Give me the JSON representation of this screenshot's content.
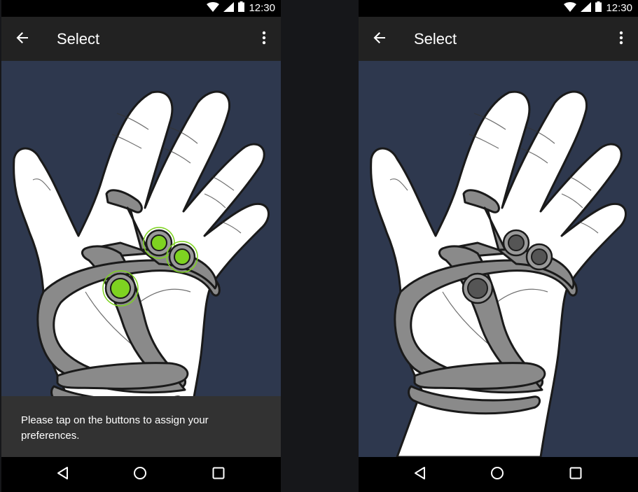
{
  "screens": [
    {
      "status": {
        "time": "12:30",
        "icons": [
          "wifi-icon",
          "cell-signal-icon",
          "battery-icon"
        ]
      },
      "app_bar": {
        "title": "Select",
        "back_icon": "arrow-back-icon",
        "menu_icon": "more-vert-icon"
      },
      "illustration": {
        "subject": "hand-controller",
        "buttons_highlighted": true,
        "highlight_color": "#7ed321"
      },
      "snackbar": {
        "message": "Please tap on the buttons to assign your preferences."
      },
      "nav": {
        "icons": [
          "nav-back-icon",
          "nav-home-icon",
          "nav-recents-icon"
        ]
      }
    },
    {
      "status": {
        "time": "12:30",
        "icons": [
          "wifi-icon",
          "cell-signal-icon",
          "battery-icon"
        ]
      },
      "app_bar": {
        "title": "Select",
        "back_icon": "arrow-back-icon",
        "menu_icon": "more-vert-icon"
      },
      "illustration": {
        "subject": "hand-controller",
        "buttons_highlighted": false,
        "button_color": "#555555"
      },
      "nav": {
        "icons": [
          "nav-back-icon",
          "nav-home-icon",
          "nav-recents-icon"
        ]
      }
    }
  ],
  "colors": {
    "background": "#2e384e",
    "app_bar": "#222222",
    "status_bar": "#000000",
    "snackbar": "#323232",
    "accent_green": "#7ed321"
  }
}
